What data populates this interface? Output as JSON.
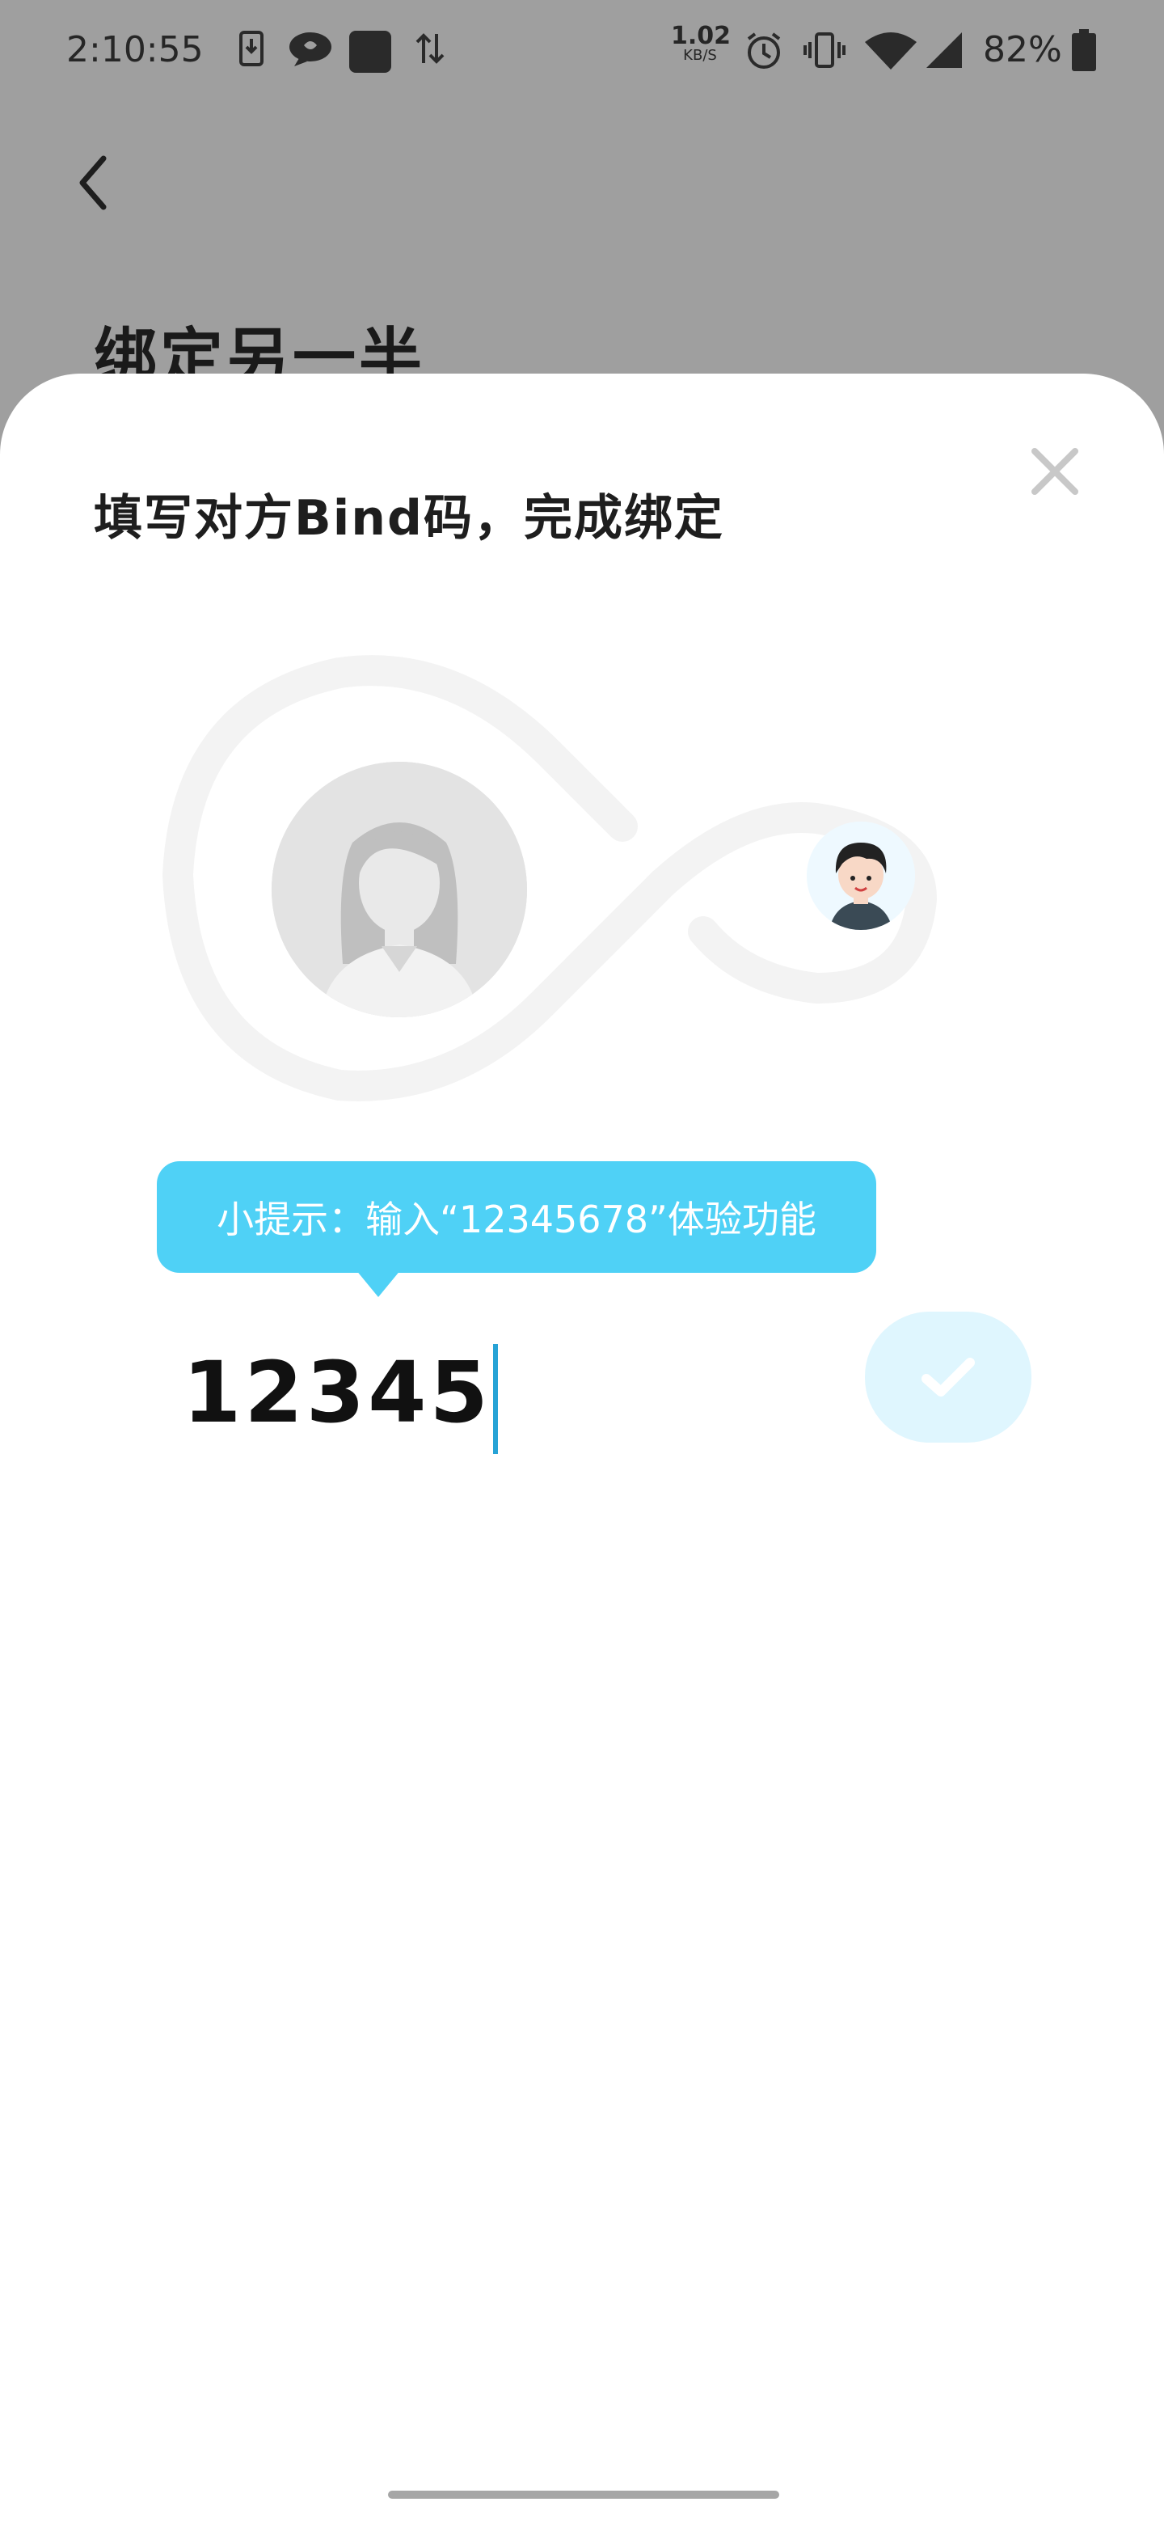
{
  "status_bar": {
    "time": "2:10:55",
    "net_speed_value": "1.02",
    "net_speed_unit": "KB/S",
    "battery": "82%",
    "icons": [
      "download-icon",
      "chat-icon",
      "app-icon",
      "data-transfer-icon",
      "alarm-icon",
      "vibrate-icon",
      "wifi-icon",
      "signal-icon",
      "battery-icon"
    ]
  },
  "page": {
    "title": "绑定另一半"
  },
  "modal": {
    "title": "填写对方Bind码，完成绑定",
    "tip": "小提示：输入“12345678”体验功能",
    "input_value": "12345",
    "colors": {
      "accent": "#4fd1f6",
      "confirm_bg": "#dff6fe",
      "caret": "#27a3d6"
    }
  }
}
